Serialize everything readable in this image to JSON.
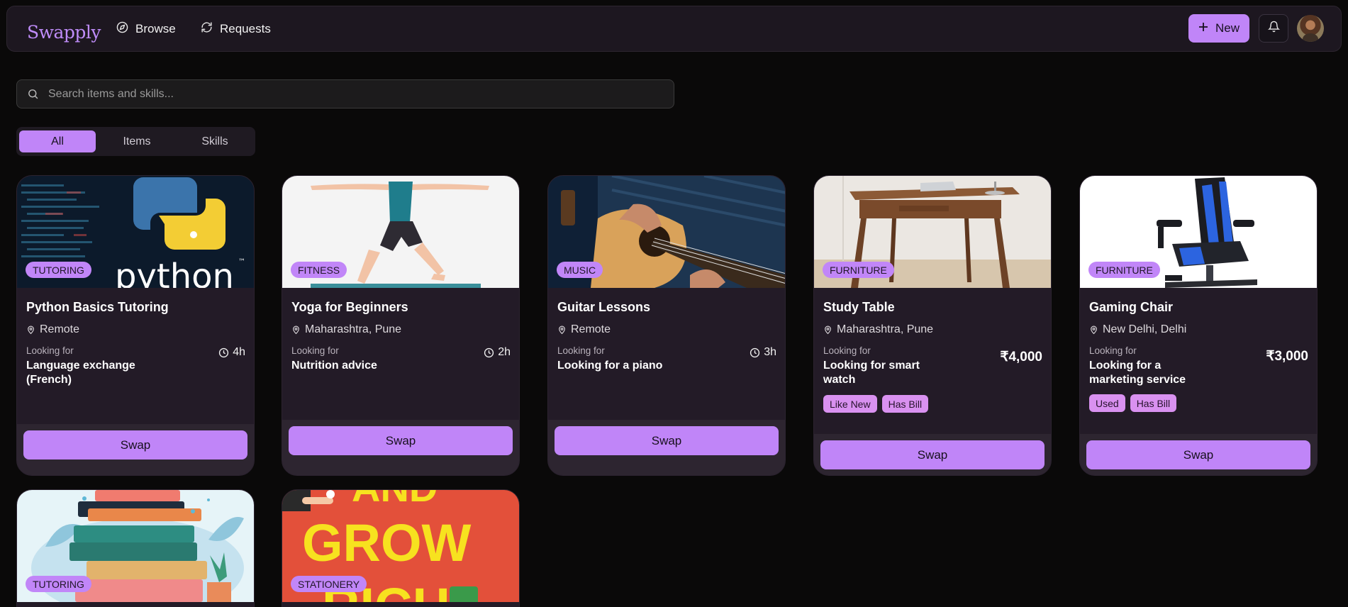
{
  "nav": {
    "logo": "Swapply",
    "browse": "Browse",
    "requests": "Requests",
    "new": "New"
  },
  "search": {
    "placeholder": "Search items and skills..."
  },
  "tabs": [
    "All",
    "Items",
    "Skills"
  ],
  "cards": [
    {
      "category": "TUTORING",
      "title": "Python Basics Tutoring",
      "location": "Remote",
      "looking_for_label": "Looking for",
      "looking_for": "Language exchange (French)",
      "duration": "4h",
      "swap": "Swap"
    },
    {
      "category": "FITNESS",
      "title": "Yoga for Beginners",
      "location": "Maharashtra, Pune",
      "looking_for_label": "Looking for",
      "looking_for": "Nutrition advice",
      "duration": "2h",
      "swap": "Swap"
    },
    {
      "category": "MUSIC",
      "title": "Guitar Lessons",
      "location": "Remote",
      "looking_for_label": "Looking for",
      "looking_for": "Looking for a piano",
      "duration": "3h",
      "swap": "Swap"
    },
    {
      "category": "FURNITURE",
      "title": "Study Table",
      "location": "Maharashtra, Pune",
      "looking_for_label": "Looking for",
      "looking_for": "Looking for smart watch",
      "price": "₹4,000",
      "tags": [
        "Like New",
        "Has Bill"
      ],
      "swap": "Swap"
    },
    {
      "category": "FURNITURE",
      "title": "Gaming Chair",
      "location": "New Delhi, Delhi",
      "looking_for_label": "Looking for",
      "looking_for": "Looking for a marketing service",
      "price": "₹3,000",
      "tags": [
        "Used",
        "Has Bill"
      ],
      "swap": "Swap"
    },
    {
      "category": "TUTORING"
    },
    {
      "category": "STATIONERY",
      "image_text": [
        "AND",
        "GROW",
        "RICH"
      ]
    }
  ],
  "image_text": {
    "python": "python",
    "tm": "™"
  },
  "colors": {
    "accent": "#c085f8",
    "background": "#0a0909",
    "card": "#231b27",
    "tag": "#d991f0"
  }
}
